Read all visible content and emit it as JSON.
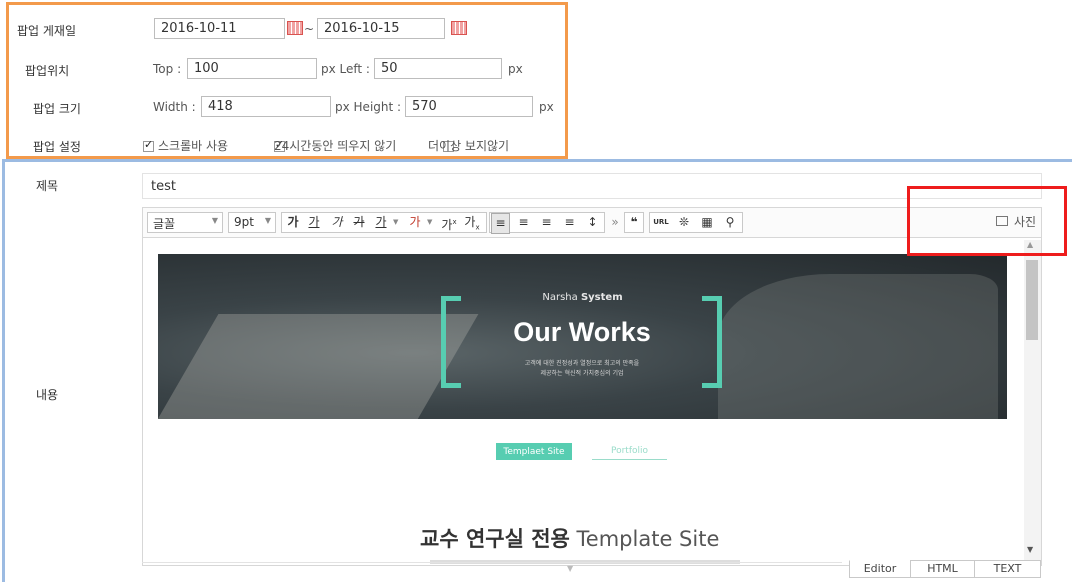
{
  "popup": {
    "period_label": "팝업 게재일",
    "start_date": "2016-10-11",
    "tilde": "~",
    "end_date": "2016-10-15",
    "position_label": "팝업위치",
    "top_label": "Top :",
    "top_value": "100",
    "px_left_label": "px Left :",
    "left_value": "50",
    "px1": "px",
    "size_label": "팝업 크기",
    "width_label": "Width :",
    "width_value": "418",
    "px_height_label": "px Height :",
    "height_value": "570",
    "px2": "px",
    "setting_label": "팝업 설정",
    "opt_scrollbar": "스크롤바 사용",
    "opt_24h": "24시간동안 띄우지 않기",
    "opt_never": "더이상 보지않기"
  },
  "form": {
    "title_label": "제목",
    "title_value": "test",
    "content_label": "내용"
  },
  "toolbar": {
    "font_select": "글꼴",
    "size_select": "9pt",
    "bold": "가",
    "underline": "가",
    "italic": "가",
    "strike": "가",
    "fontcolor": "가",
    "bgcolor": "가",
    "sup": "가",
    "sub": "가",
    "more": "»",
    "quote": "❝",
    "url": "URL",
    "photo_label": "사진"
  },
  "preview": {
    "brand_light": "Narsha ",
    "brand_bold": "System",
    "headline": "Our Works",
    "sub1": "고객에 대한 진정성과 열정으로 최고의 만족을",
    "sub2": "제공하는 혁신적 가치중심의 기업",
    "tab_active": "Templaet Site",
    "tab_inactive": "Portfolio",
    "section_title_bold": "교수 연구실 전용",
    "section_title_light": " Template Site"
  },
  "editor_tabs": [
    "Editor",
    "HTML",
    "TEXT"
  ],
  "colors": {
    "orange_border": "#f39a4b",
    "blue_border": "#9cbbe2",
    "red_highlight": "#ee1c1c",
    "accent_teal": "#57cdb1"
  }
}
